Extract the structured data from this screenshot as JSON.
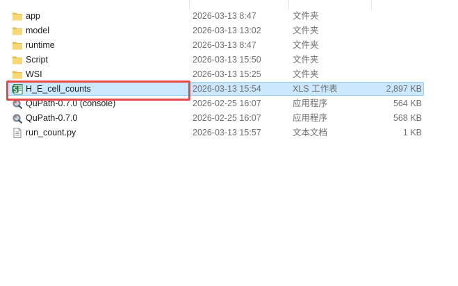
{
  "files": [
    {
      "name": "app",
      "modified": "2026-03-13 8:47",
      "type": "文件夹",
      "size": "",
      "icon": "folder-icon",
      "selected": false
    },
    {
      "name": "model",
      "modified": "2026-03-13 13:02",
      "type": "文件夹",
      "size": "",
      "icon": "folder-icon",
      "selected": false
    },
    {
      "name": "runtime",
      "modified": "2026-03-13 8:47",
      "type": "文件夹",
      "size": "",
      "icon": "folder-icon",
      "selected": false
    },
    {
      "name": "Script",
      "modified": "2026-03-13 15:50",
      "type": "文件夹",
      "size": "",
      "icon": "folder-icon",
      "selected": false
    },
    {
      "name": "WSI",
      "modified": "2026-03-13 15:25",
      "type": "文件夹",
      "size": "",
      "icon": "folder-icon",
      "selected": false
    },
    {
      "name": "H_E_cell_counts",
      "modified": "2026-03-13 15:54",
      "type": "XLS 工作表",
      "size": "2,897 KB",
      "icon": "spreadsheet-icon",
      "selected": true
    },
    {
      "name": "QuPath-0.7.0 (console)",
      "modified": "2026-02-25 16:07",
      "type": "应用程序",
      "size": "564 KB",
      "icon": "qupath-app-icon",
      "selected": false
    },
    {
      "name": "QuPath-0.7.0",
      "modified": "2026-02-25 16:07",
      "type": "应用程序",
      "size": "568 KB",
      "icon": "qupath-app-icon",
      "selected": false
    },
    {
      "name": "run_count.py",
      "modified": "2026-03-13 15:57",
      "type": "文本文档",
      "size": "1 KB",
      "icon": "text-file-icon",
      "selected": false
    }
  ],
  "colors": {
    "selection_bg": "#cce8ff",
    "selection_border": "#99d1ff",
    "annotation_highlight": "#e8474a",
    "folder": "#f8d775",
    "spreadsheet": "#1d7a45"
  }
}
